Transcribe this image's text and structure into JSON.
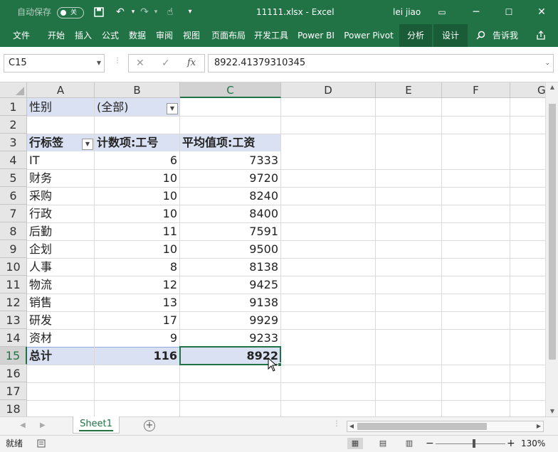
{
  "titlebar": {
    "autosave_label": "自动保存",
    "autosave_state": "关",
    "save_icon": "save-icon",
    "undo_icon": "undo-icon",
    "redo_icon": "redo-icon",
    "touch_icon": "touch-mode-icon",
    "customize_icon": "customize-qat-icon",
    "doc_title": "11111.xlsx  -  Excel",
    "user": "lei jiao"
  },
  "ribbon": {
    "tabs": [
      {
        "label": "文件"
      },
      {
        "label": "开始"
      },
      {
        "label": "插入"
      },
      {
        "label": "公式"
      },
      {
        "label": "数据"
      },
      {
        "label": "审阅"
      },
      {
        "label": "视图"
      },
      {
        "label": "页面布局"
      },
      {
        "label": "开发工具"
      },
      {
        "label": "Power BI"
      },
      {
        "label": "Power Pivot"
      },
      {
        "label": "分析"
      },
      {
        "label": "设计"
      }
    ],
    "tellme": "告诉我"
  },
  "formula_bar": {
    "name_box": "C15",
    "cancel_symbol": "✕",
    "enter_symbol": "✓",
    "fx_symbol": "fx",
    "formula": "8922.41379310345"
  },
  "sheet": {
    "columns": [
      "A",
      "B",
      "C",
      "D",
      "E",
      "F",
      "G"
    ],
    "selected_column": "C",
    "rows": [
      "1",
      "2",
      "3",
      "4",
      "5",
      "6",
      "7",
      "8",
      "9",
      "10",
      "11",
      "12",
      "13",
      "14",
      "15",
      "16",
      "17",
      "18"
    ],
    "filter": {
      "label": "性别",
      "value": "(全部)"
    },
    "pivot_headers": {
      "row_label": "行标签",
      "count": "计数项:工号",
      "avg": "平均值项:工资"
    },
    "pivot_rows": [
      {
        "label": "IT",
        "count": "6",
        "avg": "7333"
      },
      {
        "label": "财务",
        "count": "10",
        "avg": "9720"
      },
      {
        "label": "采购",
        "count": "10",
        "avg": "8240"
      },
      {
        "label": "行政",
        "count": "10",
        "avg": "8400"
      },
      {
        "label": "后勤",
        "count": "11",
        "avg": "7591"
      },
      {
        "label": "企划",
        "count": "10",
        "avg": "9500"
      },
      {
        "label": "人事",
        "count": "8",
        "avg": "8138"
      },
      {
        "label": "物流",
        "count": "12",
        "avg": "9425"
      },
      {
        "label": "销售",
        "count": "13",
        "avg": "9138"
      },
      {
        "label": "研发",
        "count": "17",
        "avg": "9929"
      },
      {
        "label": "资材",
        "count": "9",
        "avg": "9233"
      }
    ],
    "total": {
      "label": "总计",
      "count": "116",
      "avg": "8922"
    },
    "band_color": "#d9e1f2"
  },
  "sheet_tabs": {
    "active": "Sheet1",
    "add_icon": "add-sheet-icon"
  },
  "status": {
    "ready": "就绪",
    "zoom": "130%"
  },
  "colors": {
    "accent": "#217346"
  }
}
